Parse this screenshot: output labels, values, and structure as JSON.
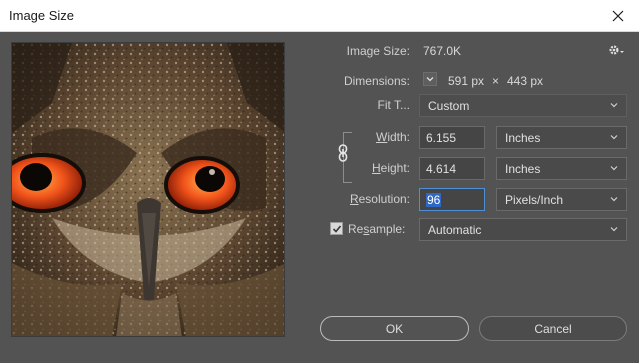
{
  "window": {
    "title": "Image Size"
  },
  "image_size": {
    "label": "Image Size:",
    "value": "767.0K"
  },
  "dimensions": {
    "label": "Dimensions:",
    "width": "591 px",
    "times": "×",
    "height": "443 px"
  },
  "fit_to": {
    "label": "Fit T...",
    "value": "Custom"
  },
  "width": {
    "label_prefix": "W",
    "label_rest": "idth:",
    "value": "6.155",
    "unit": "Inches"
  },
  "height": {
    "label_prefix": "",
    "label_u": "H",
    "label_rest": "eight:",
    "value": "4.614",
    "unit": "Inches"
  },
  "resolution": {
    "label_u": "R",
    "label_rest": "esolution:",
    "value": "96",
    "unit": "Pixels/Inch"
  },
  "resample": {
    "label_pre": "Re",
    "label_u": "s",
    "label_rest": "ample:",
    "checked": true,
    "value": "Automatic"
  },
  "buttons": {
    "ok": "OK",
    "cancel": "Cancel"
  },
  "icons": {
    "close": "close-icon",
    "gear": "gear-icon",
    "chevron": "chevron-down-icon",
    "link": "chain-link-icon",
    "check": "checkmark-icon"
  }
}
